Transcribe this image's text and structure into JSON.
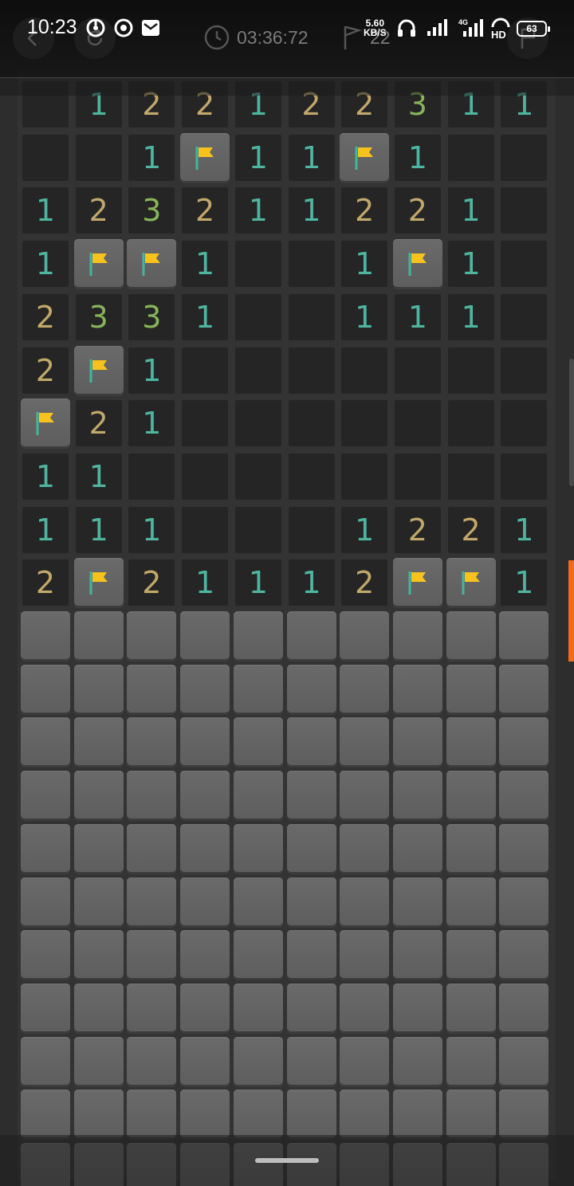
{
  "status": {
    "time": "10:23",
    "speed_value": "5.60",
    "speed_unit": "KB/S",
    "battery": "63"
  },
  "game": {
    "timer": "03:36:72",
    "flags_remaining": "22"
  },
  "board": {
    "columns": 10,
    "legend": {
      "F": "flag",
      "C": "closed",
      "0": "empty",
      "1": "1",
      "2": "2",
      "3": "3"
    },
    "rows": [
      [
        "0",
        "1",
        "2",
        "2",
        "1",
        "2",
        "2",
        "3",
        "1",
        "1"
      ],
      [
        "0",
        "0",
        "1",
        "F",
        "1",
        "1",
        "F",
        "1",
        "0",
        "0"
      ],
      [
        "1",
        "2",
        "3",
        "2",
        "1",
        "1",
        "2",
        "2",
        "1",
        "0"
      ],
      [
        "1",
        "F",
        "F",
        "1",
        "0",
        "0",
        "1",
        "F",
        "1",
        "0"
      ],
      [
        "2",
        "3",
        "3",
        "1",
        "0",
        "0",
        "1",
        "1",
        "1",
        "0"
      ],
      [
        "2",
        "F",
        "1",
        "0",
        "0",
        "0",
        "0",
        "0",
        "0",
        "0"
      ],
      [
        "F",
        "2",
        "1",
        "0",
        "0",
        "0",
        "0",
        "0",
        "0",
        "0"
      ],
      [
        "1",
        "1",
        "0",
        "0",
        "0",
        "0",
        "0",
        "0",
        "0",
        "0"
      ],
      [
        "1",
        "1",
        "1",
        "0",
        "0",
        "0",
        "1",
        "2",
        "2",
        "1"
      ],
      [
        "2",
        "F",
        "2",
        "1",
        "1",
        "1",
        "2",
        "F",
        "F",
        "1"
      ],
      [
        "C",
        "C",
        "C",
        "C",
        "C",
        "C",
        "C",
        "C",
        "C",
        "C"
      ],
      [
        "C",
        "C",
        "C",
        "C",
        "C",
        "C",
        "C",
        "C",
        "C",
        "C"
      ],
      [
        "C",
        "C",
        "C",
        "C",
        "C",
        "C",
        "C",
        "C",
        "C",
        "C"
      ],
      [
        "C",
        "C",
        "C",
        "C",
        "C",
        "C",
        "C",
        "C",
        "C",
        "C"
      ],
      [
        "C",
        "C",
        "C",
        "C",
        "C",
        "C",
        "C",
        "C",
        "C",
        "C"
      ],
      [
        "C",
        "C",
        "C",
        "C",
        "C",
        "C",
        "C",
        "C",
        "C",
        "C"
      ],
      [
        "C",
        "C",
        "C",
        "C",
        "C",
        "C",
        "C",
        "C",
        "C",
        "C"
      ],
      [
        "C",
        "C",
        "C",
        "C",
        "C",
        "C",
        "C",
        "C",
        "C",
        "C"
      ],
      [
        "C",
        "C",
        "C",
        "C",
        "C",
        "C",
        "C",
        "C",
        "C",
        "C"
      ],
      [
        "C",
        "C",
        "C",
        "C",
        "C",
        "C",
        "C",
        "C",
        "C",
        "C"
      ],
      [
        "C",
        "C",
        "C",
        "C",
        "C",
        "C",
        "C",
        "C",
        "C",
        "C"
      ]
    ]
  }
}
